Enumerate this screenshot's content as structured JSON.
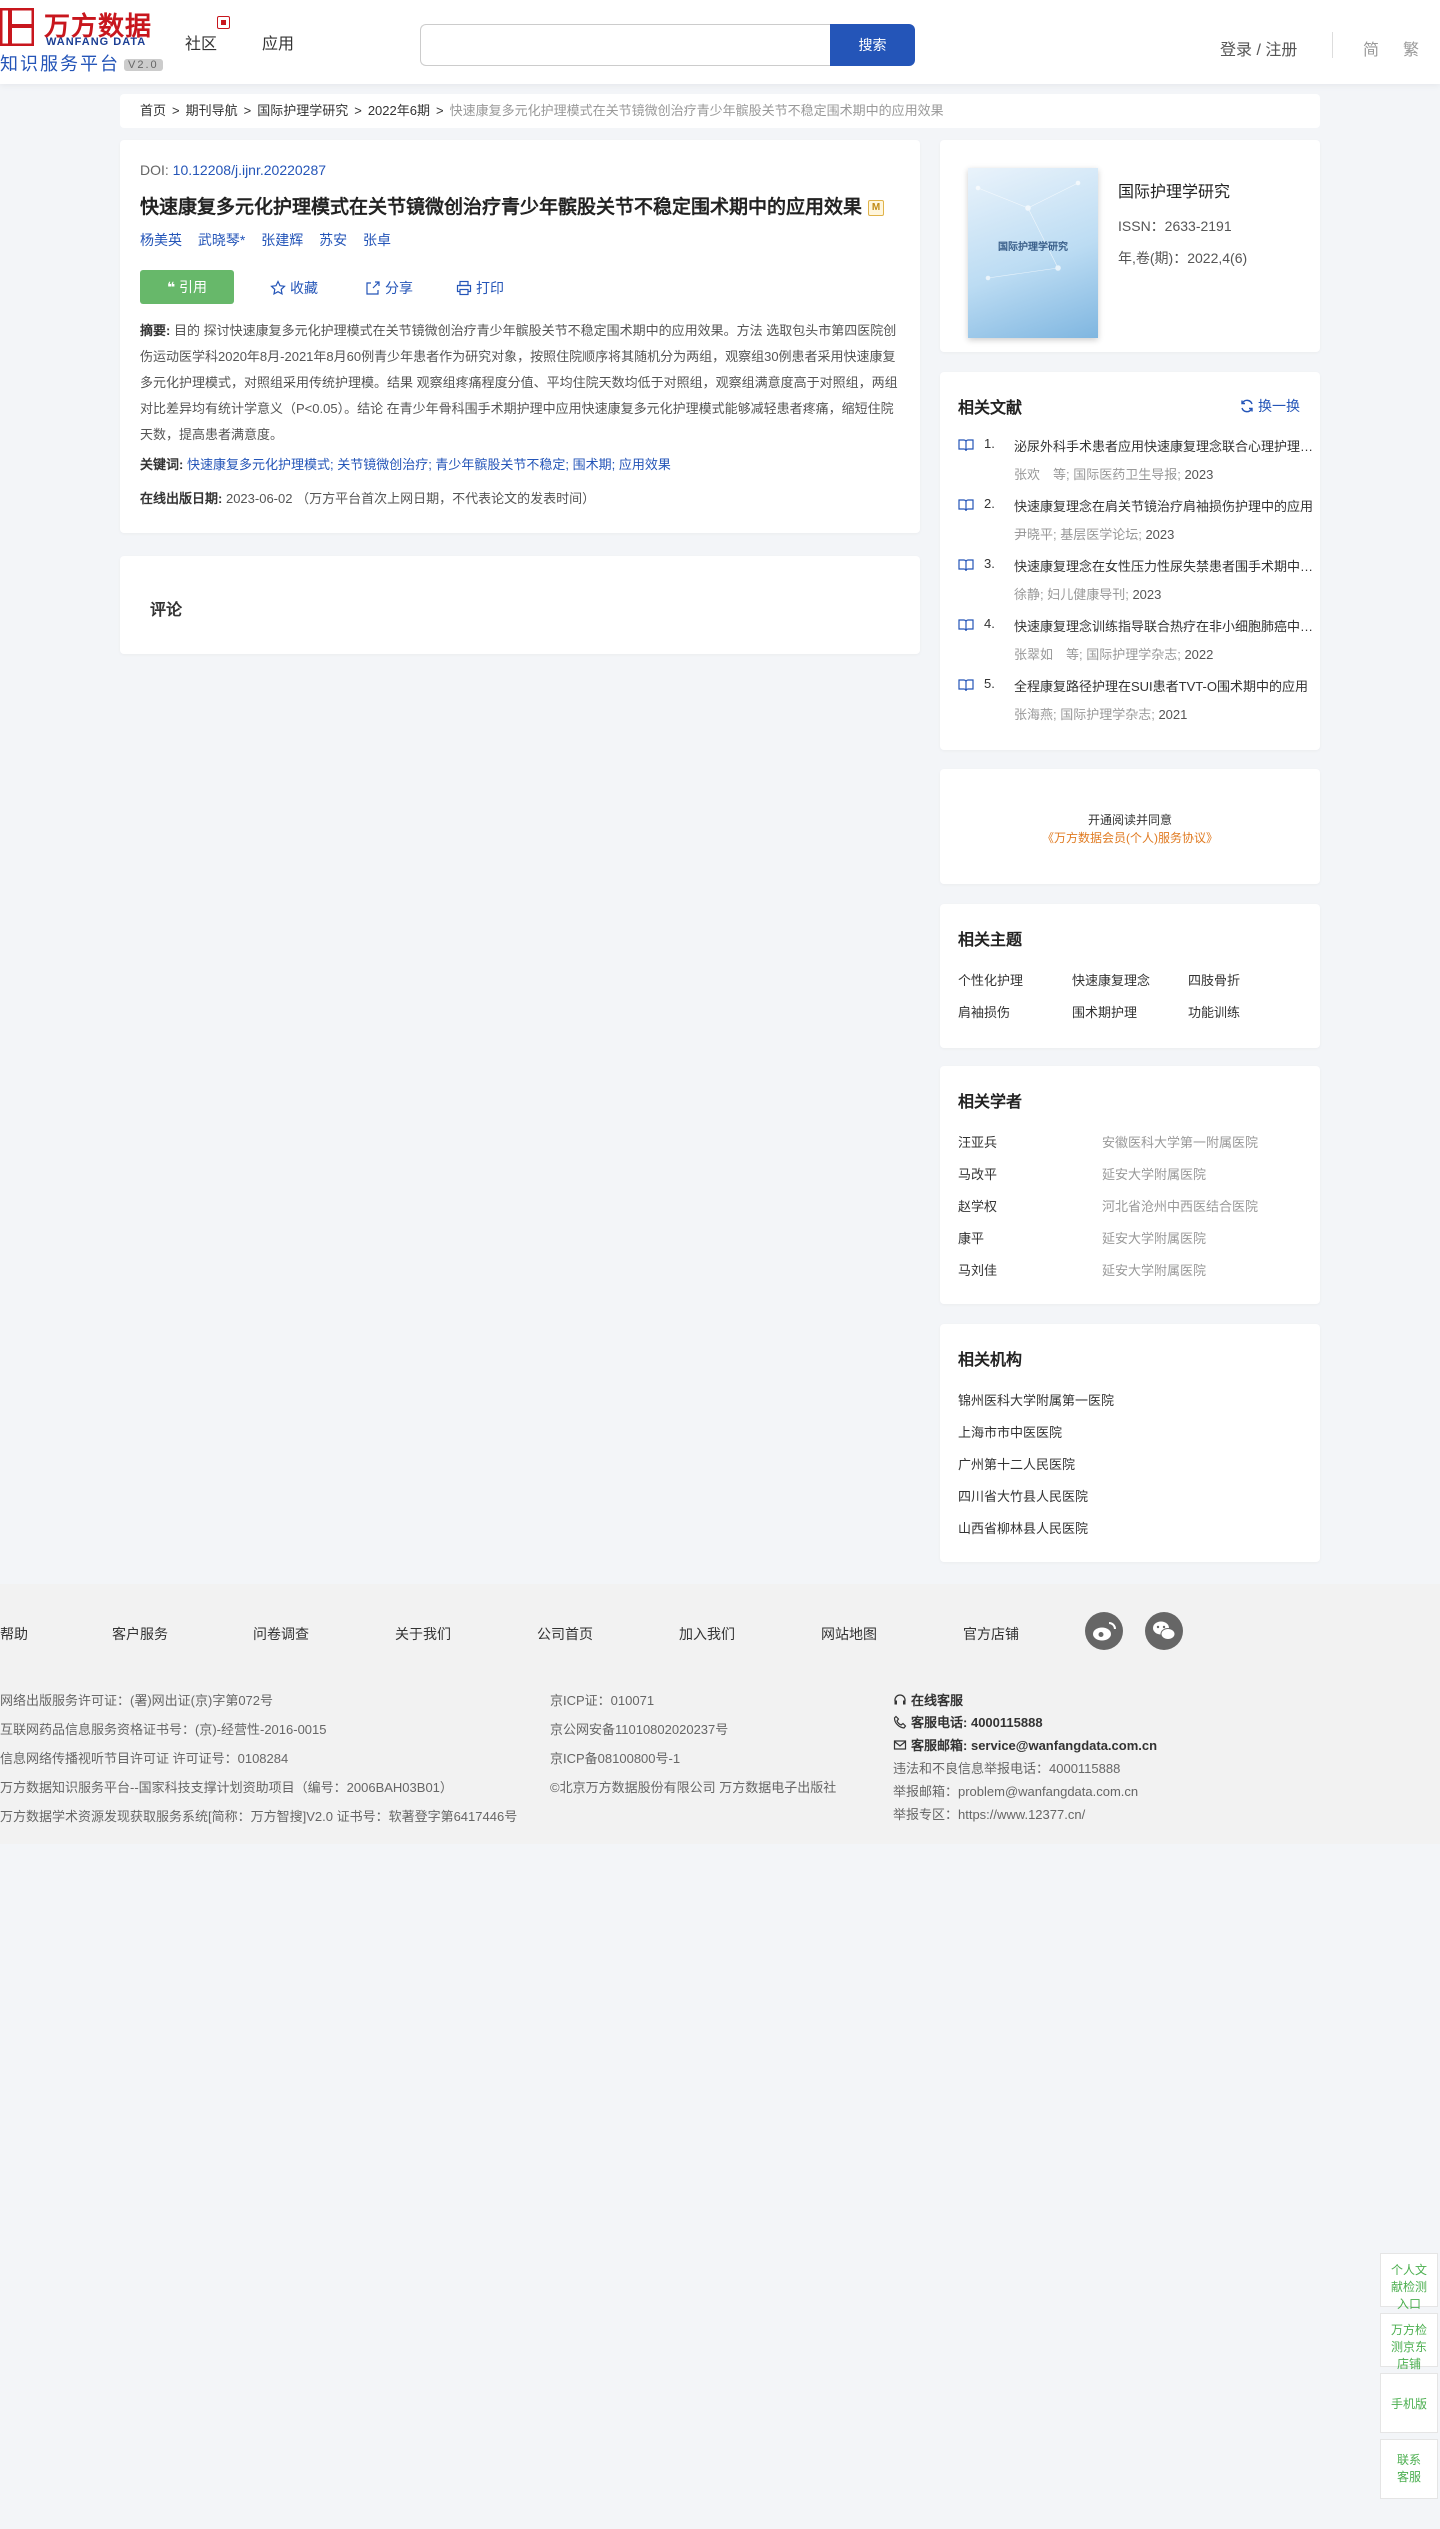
{
  "header": {
    "logo_cn": "万方数据",
    "logo_en": "WANFANG DATA",
    "logo_sub": "知识服务平台",
    "logo_version": "V2.0",
    "nav": [
      "社区",
      "应用"
    ],
    "search_button": "搜索",
    "login": "登录 / 注册",
    "lang_simplified": "简",
    "lang_traditional": "繁"
  },
  "breadcrumb": [
    "首页",
    "期刊导航",
    "国际护理学研究",
    "2022年6期",
    "快速康复多元化护理模式在关节镜微创治疗青少年髌股关节不稳定围术期中的应用效果"
  ],
  "article": {
    "doi_label": "DOI:",
    "doi": "10.12208/j.ijnr.20220287",
    "title": "快速康复多元化护理模式在关节镜微创治疗青少年髌股关节不稳定围术期中的应用效果",
    "m_badge": "M",
    "authors": [
      "杨美英",
      "武晓琴*",
      "张建辉",
      "苏安",
      "张卓"
    ],
    "cite": "引用",
    "collect": "收藏",
    "share": "分享",
    "print": "打印",
    "abstract_label": "摘要:",
    "abstract": "目的 探讨快速康复多元化护理模式在关节镜微创治疗青少年髌股关节不稳定围术期中的应用效果。方法 选取包头市第四医院创伤运动医学科2020年8月-2021年8月60例青少年患者作为研究对象，按照住院顺序将其随机分为两组，观察组30例患者采用快速康复多元化护理模式，对照组采用传统护理模。结果 观察组疼痛程度分值、平均住院天数均低于对照组，观察组满意度高于对照组，两组对比差异均有统计学意义（P<0.05）。结论 在青少年骨科围手术期护理中应用快速康复多元化护理模式能够减轻患者疼痛，缩短住院天数，提高患者满意度。",
    "keywords_label": "关键词:",
    "keywords": "快速康复多元化护理模式; 关节镜微创治疗; 青少年髌股关节不稳定; 围术期; 应用效果",
    "pubdate_label": "在线出版日期:",
    "pubdate": "2023-06-02",
    "pubdate_note": "（万方平台首次上网日期，不代表论文的发表时间）"
  },
  "comment": {
    "title": "评论"
  },
  "journal": {
    "cover_title": "国际护理学研究",
    "name": "国际护理学研究",
    "issn": "ISSN：2633-2191",
    "volume": "年,卷(期)：2022,4(6)"
  },
  "related_docs": {
    "title": "相关文献",
    "refresh": "换一换",
    "items": [
      {
        "num": "1.",
        "title": "泌尿外科手术患者应用快速康复理念联合心理护理的效果分析",
        "authors": "张欢　等; 国际医药卫生导报; ",
        "year": "2023"
      },
      {
        "num": "2.",
        "title": "快速康复理念在肩关节镜治疗肩袖损伤护理中的应用",
        "authors": "尹晓平; 基层医学论坛; ",
        "year": "2023"
      },
      {
        "num": "3.",
        "title": "快速康复理念在女性压力性尿失禁患者围手术期中的应用",
        "authors": "徐静; 妇儿健康导刊; ",
        "year": "2023"
      },
      {
        "num": "4.",
        "title": "快速康复理念训练指导联合热疗在非小细胞肺癌中的应用",
        "authors": "张翠如　等; 国际护理学杂志; ",
        "year": "2022"
      },
      {
        "num": "5.",
        "title": "全程康复路径护理在SUI患者TVT-O围术期中的应用",
        "authors": "张海燕; 国际护理学杂志; ",
        "year": "2021"
      }
    ]
  },
  "vip": {
    "line1": "开通阅读并同意",
    "line2": "《万方数据会员(个人)服务协议》"
  },
  "topics": {
    "title": "相关主题",
    "items": [
      "个性化护理",
      "快速康复理念",
      "四肢骨折",
      "肩袖损伤",
      "围术期护理",
      "功能训练"
    ]
  },
  "scholars": {
    "title": "相关学者",
    "items": [
      {
        "name": "汪亚兵",
        "org": "安徽医科大学第一附属医院"
      },
      {
        "name": "马改平",
        "org": "延安大学附属医院"
      },
      {
        "name": "赵学权",
        "org": "河北省沧州中西医结合医院"
      },
      {
        "name": "康平",
        "org": "延安大学附属医院"
      },
      {
        "name": "马刘佳",
        "org": "延安大学附属医院"
      }
    ]
  },
  "institutions": {
    "title": "相关机构",
    "items": [
      "锦州医科大学附属第一医院",
      "上海市市中医医院",
      "广州第十二人民医院",
      "四川省大竹县人民医院",
      "山西省柳林县人民医院"
    ]
  },
  "footer": {
    "links": [
      "帮助",
      "客户服务",
      "问卷调查",
      "关于我们",
      "公司首页",
      "加入我们",
      "网站地图",
      "官方店铺"
    ],
    "col1": [
      "网络出版服务许可证：(署)网出证(京)字第072号",
      "互联网药品信息服务资格证书号：(京)-经营性-2016-0015",
      "信息网络传播视听节目许可证 许可证号：0108284",
      "万方数据知识服务平台--国家科技支撑计划资助项目（编号：2006BAH03B01）",
      "万方数据学术资源发现获取服务系统[简称：万方智搜]V2.0 证书号：软著登字第6417446号"
    ],
    "col2": [
      "京ICP证：010071",
      "京公网安备11010802020237号",
      "京ICP备08100800号-1",
      "©北京万方数据股份有限公司 万方数据电子出版社"
    ],
    "online_service": "在线客服",
    "phone_label": "客服电话:",
    "phone": "4000115888",
    "email_label": "客服邮箱:",
    "email": "service@wanfangdata.com.cn",
    "report_phone": "违法和不良信息举报电话：4000115888",
    "report_email": "举报邮箱：problem@wanfangdata.com.cn",
    "report_area": "举报专区：https://www.12377.cn/"
  },
  "float_bar": {
    "check1": "个人文献检测入口",
    "check2": "万方检测京东店铺",
    "mobile": "手机版",
    "contact": "联系客服"
  }
}
